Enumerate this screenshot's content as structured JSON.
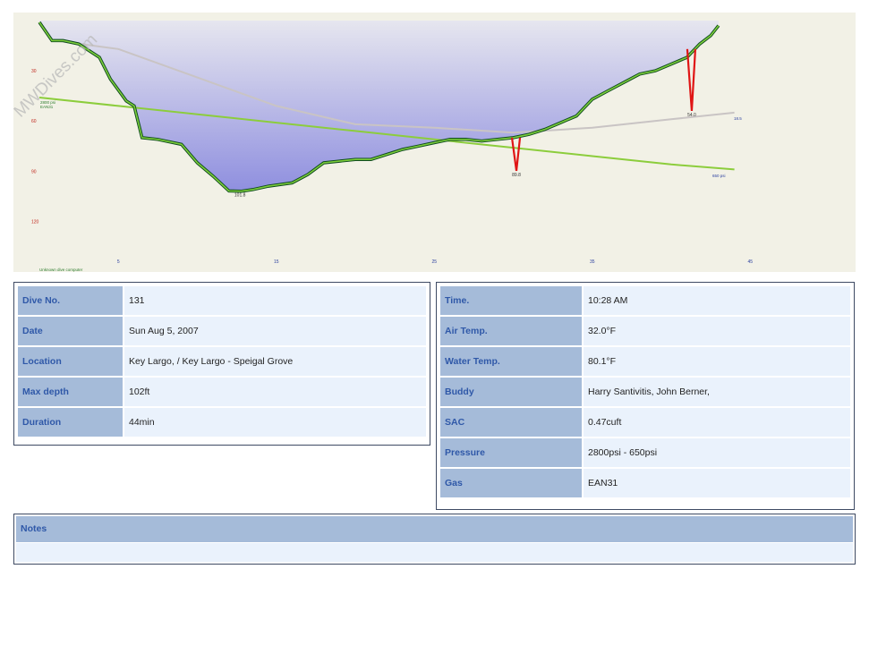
{
  "watermark": "MWDives.com",
  "chart_data": {
    "type": "area",
    "x_ticks": [
      "5",
      "15",
      "25",
      "35",
      "45"
    ],
    "y_ticks": [
      "30",
      "60",
      "90",
      "120"
    ],
    "xlim": [
      0,
      51
    ],
    "ylim": [
      0,
      136
    ],
    "depth_profile": {
      "x": [
        0,
        0.8,
        1.5,
        2.5,
        3.8,
        4.5,
        5.5,
        6,
        6.5,
        7.5,
        9,
        10,
        11,
        12,
        12.8,
        13.5,
        14.5,
        16,
        17,
        18,
        19,
        20,
        21,
        22,
        23,
        24,
        25,
        26,
        27,
        28,
        29,
        30,
        31,
        32,
        33,
        34,
        35,
        36,
        37,
        38,
        39,
        40,
        41,
        41.8,
        42.5,
        43
      ],
      "y": [
        1,
        12,
        12,
        14,
        22,
        35,
        48,
        51,
        70,
        71,
        74,
        85,
        93,
        101.8,
        102,
        101,
        99,
        97,
        92,
        85,
        84,
        83,
        83,
        80,
        77,
        75,
        73,
        71,
        71,
        72,
        71,
        70,
        68,
        65,
        61,
        57,
        47,
        42,
        37,
        32,
        30,
        26,
        22,
        14,
        9,
        3
      ]
    },
    "depth_spikes": [
      {
        "x": 30.2,
        "base": 70,
        "peak": 89.8,
        "label": "89.8"
      },
      {
        "x": 41.3,
        "base": 17,
        "peak": 54.0,
        "label": "54.0"
      }
    ],
    "min_depth_label": {
      "x": 12.7,
      "y": 101.8,
      "text": "101.8"
    },
    "tank_pressure_line": {
      "x": [
        0,
        5,
        10,
        15,
        20,
        25,
        30,
        35,
        40,
        44
      ],
      "y": [
        46,
        51,
        56,
        61,
        66,
        71,
        76,
        81,
        86,
        89
      ]
    },
    "secondary_line": {
      "x": [
        1,
        5,
        10,
        15,
        20,
        25,
        30,
        35,
        40,
        44
      ],
      "y": [
        12,
        17,
        34,
        51,
        62,
        64,
        67,
        64,
        59,
        55
      ]
    },
    "labels": {
      "start_pressure": "2800 psi",
      "gas": "EAN31",
      "end_pressure": "650 psi",
      "end_secondary": "18.5",
      "computer": "Unknown dive computer"
    }
  },
  "left_table": [
    {
      "label": "Dive No.",
      "value": "131"
    },
    {
      "label": "Date",
      "value": "Sun Aug 5, 2007"
    },
    {
      "label": "Location",
      "value": "Key Largo, / Key Largo - Speigal Grove"
    },
    {
      "label": "Max depth",
      "value": "102ft"
    },
    {
      "label": "Duration",
      "value": "44min"
    }
  ],
  "right_table": [
    {
      "label": "Time.",
      "value": "10:28 AM"
    },
    {
      "label": "Air Temp.",
      "value": "32.0°F"
    },
    {
      "label": "Water Temp.",
      "value": "80.1°F"
    },
    {
      "label": "Buddy",
      "value": "Harry Santivitis, John Berner,"
    },
    {
      "label": "SAC",
      "value": "0.47cuft"
    },
    {
      "label": "Pressure",
      "value": "2800psi - 650psi"
    },
    {
      "label": "Gas",
      "value": "EAN31"
    }
  ],
  "notes": {
    "label": "Notes",
    "value": ""
  },
  "colors": {
    "plot_bg": "#f2f1e6",
    "profile_outline": "#0d4a1e",
    "profile_green": "#7ccd3a",
    "spike_red": "#e01515",
    "tank_line": "#8ccd3c",
    "header_cell": "#a5bbd9",
    "value_cell": "#eaf2fc"
  }
}
